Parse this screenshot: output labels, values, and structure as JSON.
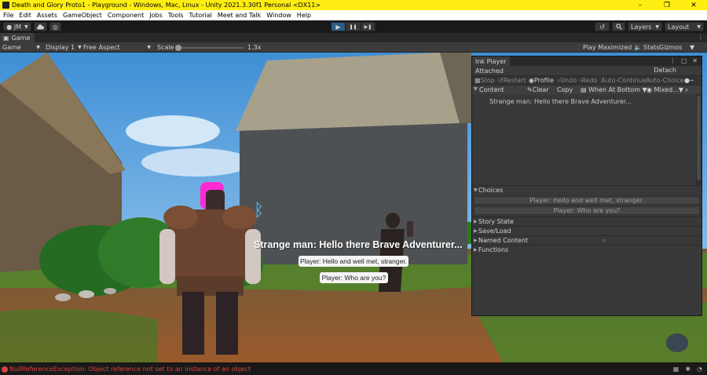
{
  "window": {
    "title": "Death and Glory Proto1 - Playground - Windows, Mac, Linux - Unity 2021.3.30f1 Personal <DX11>",
    "minimize": "–",
    "maximize": "❐",
    "close": "✕"
  },
  "menu": [
    "File",
    "Edit",
    "Assets",
    "GameObject",
    "Component",
    "Jobs",
    "Tools",
    "Tutorial",
    "Meet and Talk",
    "Window",
    "Help"
  ],
  "toolbar": {
    "account": "JM",
    "layers": "Layers",
    "layout": "Layout",
    "play": "▶",
    "pause": "❚❚",
    "step": "▶❚"
  },
  "game_tab": {
    "label": "Game"
  },
  "game_bar": {
    "view": "Game",
    "display": "Display 1",
    "aspect": "Free Aspect",
    "scale_label": "Scale",
    "scale_value": "1.3x",
    "play_mode": "Play Maximized",
    "stats": "Stats",
    "gizmos": "Gizmos"
  },
  "dialogue": {
    "line": "Strange man: Hello there Brave Adventurer...",
    "choices": [
      "Player: Hello and well met, stranger.",
      "Player: Who are you?"
    ]
  },
  "ink_player": {
    "tab": "Ink Player",
    "attached": "Attached",
    "detach": "Detach",
    "controls": {
      "stop": "Stop",
      "restart": "Restart",
      "profile": "Profile",
      "undo": "Undo",
      "redo": "Redo",
      "auto_continue": "Auto-Continue",
      "auto_choice": "Auto-Choice"
    },
    "content_header": {
      "label": "Content",
      "clear": "Clear",
      "copy": "Copy",
      "position": "When At Bottom",
      "filter": "Mixed..."
    },
    "content_lines": [
      "Strange man: Hello there Brave Adventurer..."
    ],
    "choices_label": "Choices",
    "choices": [
      "Player: Hello and well met, stranger.",
      "Player: Who are you?"
    ],
    "sections": [
      "Story State",
      "Save/Load",
      "Named Content",
      "Functions"
    ]
  },
  "status": {
    "message": "NullReferenceException: Object reference not set to an instance of an object"
  },
  "colors": {
    "title_bar": "#ffee11",
    "play_active": "#2c5d87",
    "error": "#d8443d"
  }
}
